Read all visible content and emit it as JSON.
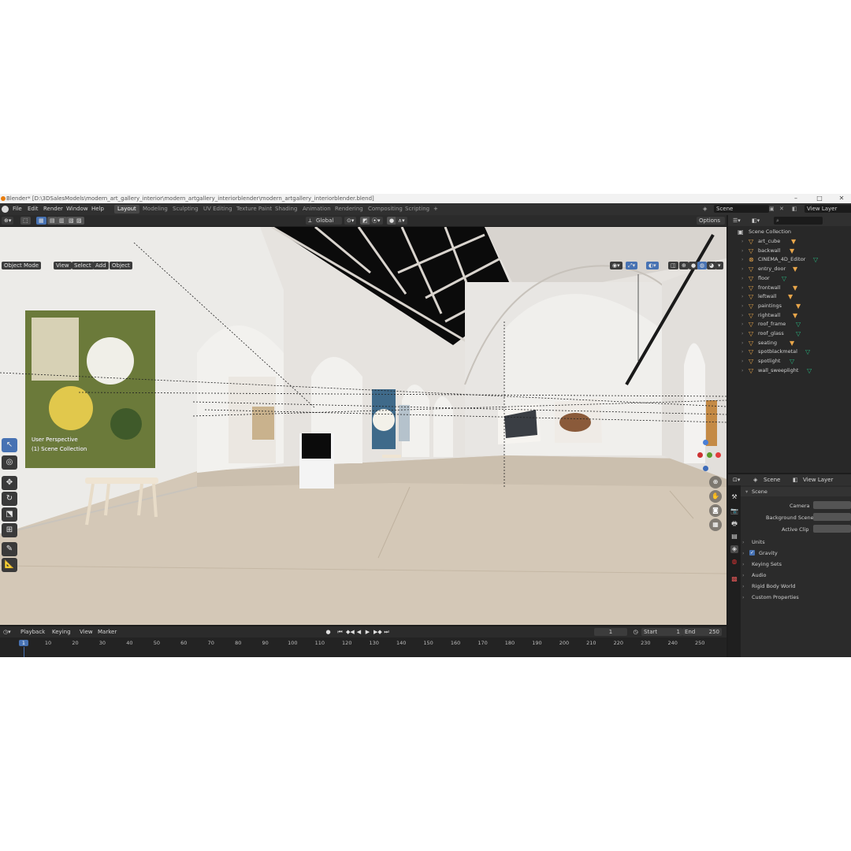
{
  "window": {
    "title": "Blender* [D:\\3DSalesModels\\modern_art_gallery_interior\\modern_artgallery_interiorblender\\modern_artgallery_interiorblender.blend]"
  },
  "menu": [
    "File",
    "Edit",
    "Render",
    "Window",
    "Help"
  ],
  "workspaces": [
    "Layout",
    "Modeling",
    "Sculpting",
    "UV Editing",
    "Texture Paint",
    "Shading",
    "Animation",
    "Rendering",
    "Compositing",
    "Scripting"
  ],
  "active_workspace": "Layout",
  "scene_field": "Scene",
  "view_layer_field": "View Layer",
  "header": {
    "mode": "Object Mode",
    "view": "View",
    "select": "Select",
    "add": "Add",
    "object": "Object",
    "orientation": "Global",
    "options": "Options"
  },
  "viewport": {
    "perspective": "User Perspective",
    "collection": "(1) Scene Collection"
  },
  "outliner": {
    "root": "Scene Collection",
    "items": [
      "art_cube",
      "backwall",
      "CINEMA_4D_Editor",
      "entry_door",
      "floor",
      "frontwall",
      "leftwall",
      "paintings",
      "rightwall",
      "roof_frame",
      "roof_glass",
      "seating",
      "spotblackmetal",
      "spotlight",
      "wall_sweeplight"
    ]
  },
  "properties": {
    "tab_scene": "Scene",
    "tab_view_layer": "View Layer",
    "section": "Scene",
    "camera_label": "Camera",
    "background_label": "Background Scene",
    "clip_label": "Active Clip",
    "panels": [
      "Units",
      "Gravity",
      "Keying Sets",
      "Audio",
      "Rigid Body World",
      "Custom Properties"
    ],
    "gravity_checked": true
  },
  "timeline": {
    "playback": "Playback",
    "keying": "Keying",
    "view": "View",
    "marker": "Marker",
    "current_frame": "1",
    "start_label": "Start",
    "start": "1",
    "end_label": "End",
    "end": "250",
    "ticks": [
      "1",
      "10",
      "20",
      "30",
      "40",
      "50",
      "60",
      "70",
      "80",
      "90",
      "100",
      "110",
      "120",
      "130",
      "140",
      "150",
      "160",
      "170",
      "180",
      "190",
      "200",
      "210",
      "220",
      "230",
      "240",
      "250"
    ]
  },
  "colors": {
    "accent": "#4772b3",
    "blender_orange": "#e87d0d",
    "mesh_icon": "#e9a64a",
    "modifier_green": "#28b47e"
  }
}
